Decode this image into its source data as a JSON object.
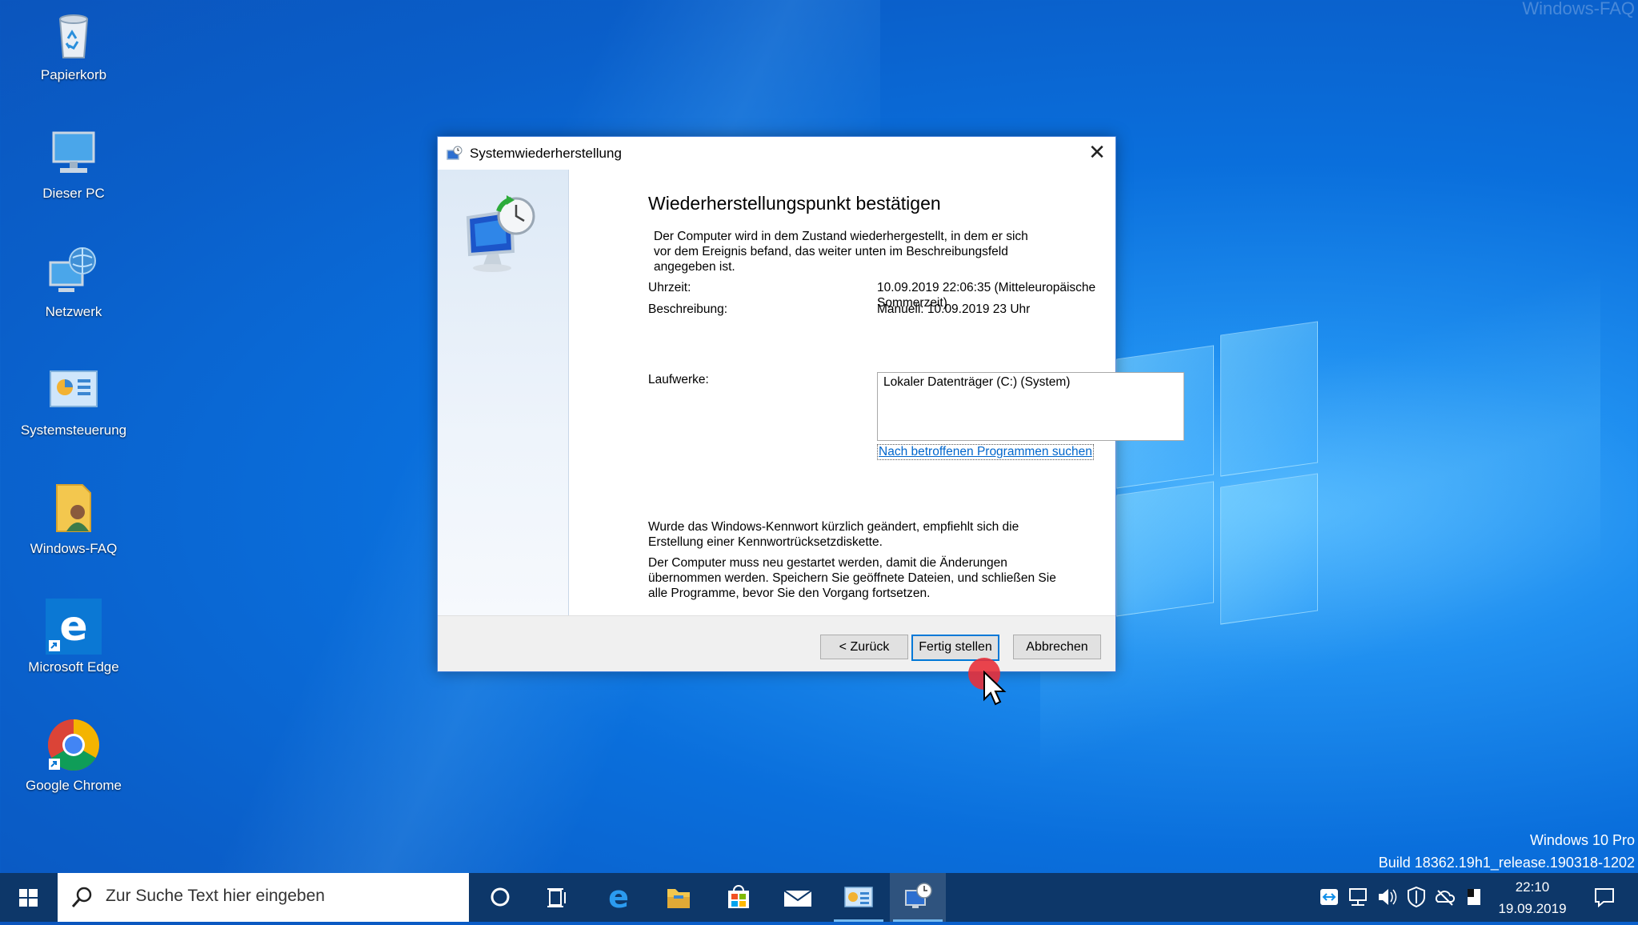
{
  "desktop": {
    "watermark": "Windows-FAQ",
    "os_edition": "Windows 10 Pro",
    "build": "Build 18362.19h1_release.190318-1202",
    "icons": [
      {
        "label": "Papierkorb",
        "icon": "recycle-bin-icon"
      },
      {
        "label": "Dieser PC",
        "icon": "computer-icon"
      },
      {
        "label": "Netzwerk",
        "icon": "network-icon"
      },
      {
        "label": "Systemsteuerung",
        "icon": "control-panel-icon"
      },
      {
        "label": "Windows-FAQ",
        "icon": "user-folder-icon"
      },
      {
        "label": "Microsoft Edge",
        "icon": "edge-icon"
      },
      {
        "label": "Google Chrome",
        "icon": "chrome-icon"
      }
    ]
  },
  "dialog": {
    "title": "Systemwiederherstellung",
    "heading": "Wiederherstellungspunkt bestätigen",
    "intro_line1": "Der Computer wird in dem Zustand wiederhergestellt, in dem er sich",
    "intro_line2": "vor dem Ereignis befand, das weiter unten im Beschreibungsfeld",
    "intro_line3": "angegeben ist.",
    "time_label": "Uhrzeit:",
    "time_value": "10.09.2019 22:06:35 (Mitteleuropäische Sommerzeit)",
    "desc_label": "Beschreibung:",
    "desc_value": "Manuell: 10.09.2019 23 Uhr",
    "drives_label": "Laufwerke:",
    "drives_value": "Lokaler Datenträger (C:) (System)",
    "link": "Nach betroffenen Programmen suchen",
    "note1_line1": "Wurde das Windows-Kennwort kürzlich geändert, empfiehlt sich die",
    "note1_line2": "Erstellung einer Kennwortrücksetzdiskette.",
    "note2_line1": "Der Computer muss neu gestartet werden, damit die Änderungen",
    "note2_line2": "übernommen werden. Speichern Sie geöffnete Dateien, und schließen Sie",
    "note2_line3": "alle Programme, bevor Sie den Vorgang fortsetzen.",
    "back_button": "< Zurück",
    "finish_button": "Fertig stellen",
    "cancel_button": "Abbrechen",
    "close_glyph": "✕"
  },
  "taskbar": {
    "search_placeholder": "Zur Suche Text hier eingeben",
    "clock_time": "22:10",
    "clock_date": "19.09.2019",
    "accent_color": "#0d3769"
  }
}
